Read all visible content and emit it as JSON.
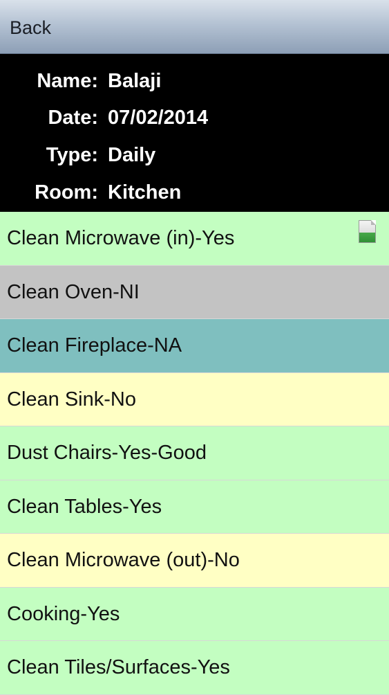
{
  "navbar": {
    "back_label": "Back"
  },
  "info": {
    "name_label": "Name:",
    "name_value": "Balaji",
    "date_label": "Date:",
    "date_value": "07/02/2014",
    "type_label": "Type:",
    "type_value": "Daily",
    "room_label": "Room:",
    "room_value": "Kitchen"
  },
  "colors": {
    "yes": "#c3fec1",
    "ni": "#c3c3c3",
    "na": "#7fbfbf",
    "no": "#ffffc4"
  },
  "tasks": [
    {
      "label": "Clean Microwave (in)-Yes",
      "status": "yes",
      "has_photo": true,
      "photo_icon": "photo-thumbnail-icon"
    },
    {
      "label": "Clean Oven-NI",
      "status": "ni"
    },
    {
      "label": "Clean Fireplace-NA",
      "status": "na"
    },
    {
      "label": "Clean Sink-No",
      "status": "no"
    },
    {
      "label": "Dust Chairs-Yes-Good",
      "status": "yes"
    },
    {
      "label": "Clean Tables-Yes",
      "status": "yes"
    },
    {
      "label": "Clean Microwave (out)-No",
      "status": "no"
    },
    {
      "label": "Cooking-Yes",
      "status": "yes"
    },
    {
      "label": "Clean Tiles/Surfaces-Yes",
      "status": "yes"
    }
  ]
}
